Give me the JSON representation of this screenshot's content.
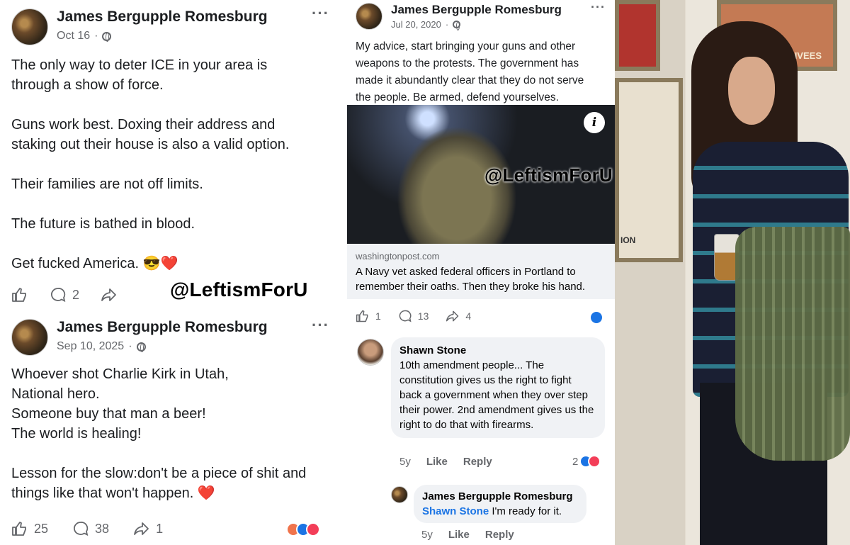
{
  "left": {
    "post1": {
      "author": "James Bergupple Romesburg",
      "date": "Oct 16",
      "text": "The only way to deter ICE in your area is\nthrough a show of force.\n\nGuns work best. Doxing their address and\nstaking out their house is also a valid option.\n\nTheir families are not off limits.\n\nThe future is bathed in blood.\n\nGet fucked America. 😎❤️",
      "comment_count": "2"
    },
    "watermark": "@LeftismForU",
    "post2": {
      "author": "James Bergupple Romesburg",
      "date": "Sep 10, 2025",
      "text": "Whoever shot Charlie Kirk in Utah,\nNational hero.\nSomeone buy that man a beer!\nThe world is healing!\n\nLesson for the slow:don't be a piece of shit and\nthings like that won't happen.  ❤️",
      "like_count": "25",
      "comment_count": "38",
      "share_count": "1"
    }
  },
  "mid": {
    "author": "James Bergupple Romesburg",
    "date": "Jul 20, 2020",
    "text": "My advice, start bringing your guns and other\nweapons to the protests. The government has\nmade it abundantly clear that they do not serve\nthe people. Be armed, defend yourselves.",
    "photo_watermark": "@LeftismForU",
    "info_glyph": "i",
    "link_domain": "washingtonpost.com",
    "link_title": "A Navy vet asked federal officers in Portland to remember their oaths. Then they broke his hand.",
    "like_count": "1",
    "comment_count": "13",
    "share_count": "4",
    "comment1": {
      "name": "Shawn Stone",
      "text": "10th amendment people... The constitution gives us the right to fight back a government when they over step their power. 2nd amendment gives us the right to do that with firearms.",
      "age": "5y",
      "like": "Like",
      "reply": "Reply",
      "reaction_count": "2"
    },
    "reply1": {
      "name": "James Bergupple Romesburg",
      "mention": "Shawn Stone",
      "text": " I'm ready for it.",
      "age": "5y",
      "like": "Like",
      "reply": "Reply"
    }
  },
  "right": {
    "sign1": "PRIVEES",
    "sign2": "ION"
  },
  "colors": {
    "link_blue": "#1b74e4",
    "meta_gray": "#65676b",
    "comment_bg": "#f0f2f5"
  }
}
